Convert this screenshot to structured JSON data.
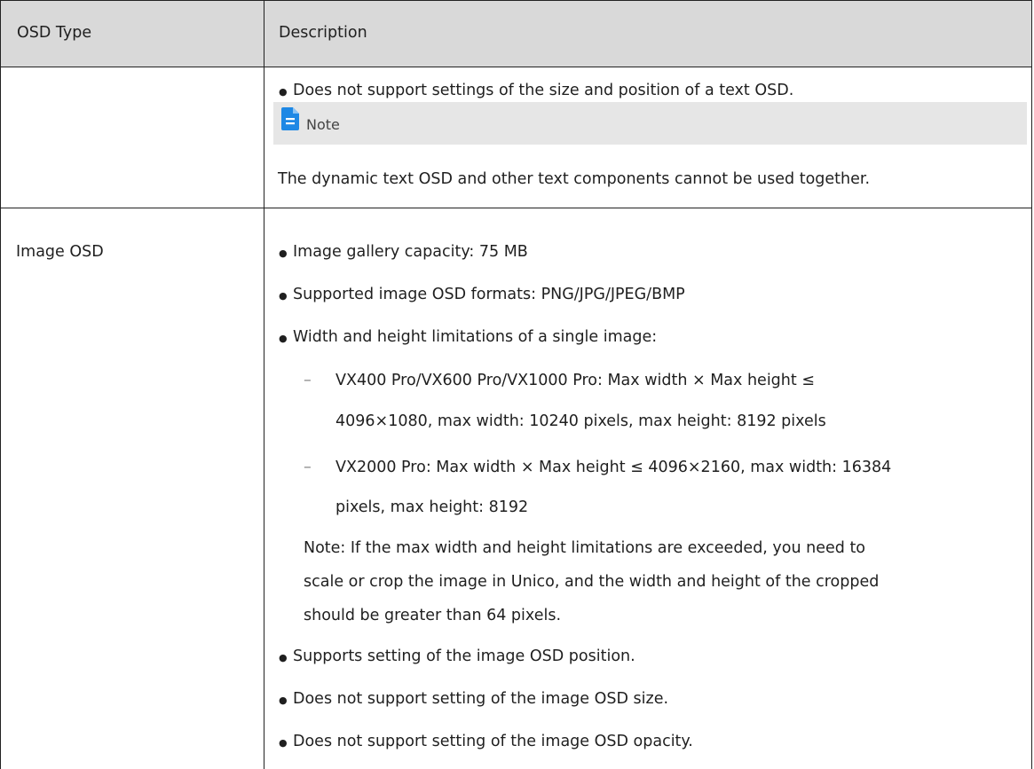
{
  "table": {
    "headers": {
      "type": "OSD Type",
      "description": "Description"
    },
    "row1": {
      "type": "",
      "bullet1": "Does not support settings of the size and position of a text OSD.",
      "note_label": "Note",
      "note_text": "The dynamic text OSD and other text components cannot be used together."
    },
    "row2": {
      "type": "Image OSD",
      "b1": "Image gallery capacity: 75 MB",
      "b2": "Supported image OSD formats: PNG/JPG/JPEG/BMP",
      "b3": "Width and height limitations of a single image:",
      "sub1_l1": "VX400 Pro/VX600 Pro/VX1000 Pro: Max width × Max height ≤",
      "sub1_l2": "4096×1080, max width: 10240 pixels, max height: 8192 pixels",
      "sub2_l1": "VX2000 Pro: Max width × Max height ≤ 4096×2160, max width: 16384",
      "sub2_l2": "pixels, max height: 8192",
      "note_l1": "Note: If the max width and height limitations are exceeded, you need to",
      "note_l2": "scale or crop the image in Unico, and the width and height of the cropped",
      "note_l3": "should be greater than 64 pixels.",
      "b4": "Supports setting of the image OSD position.",
      "b5": "Does not support setting of the image OSD size.",
      "b6": "Does not support setting of the image OSD opacity."
    }
  },
  "colors": {
    "header_bg": "#d9d9d9",
    "note_bg": "#e6e6e6",
    "note_icon": "#1e88e5",
    "border": "#222222"
  }
}
